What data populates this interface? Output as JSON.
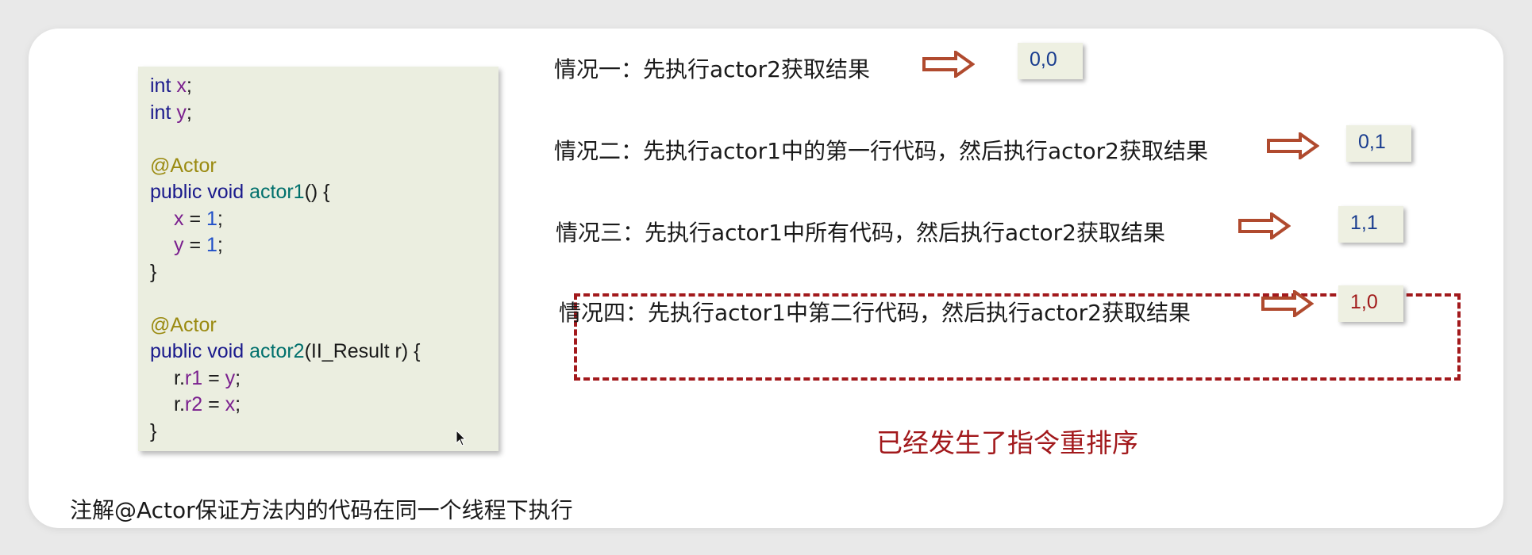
{
  "code": {
    "line1": [
      "int",
      "x",
      ";"
    ],
    "line2": [
      "int",
      "y",
      ";"
    ],
    "line3": "@Actor",
    "line4": [
      "public void",
      "actor1",
      "() {"
    ],
    "line5": [
      "x",
      " = ",
      "1",
      ";"
    ],
    "line6": [
      "y",
      " = ",
      "1",
      ";"
    ],
    "line7": "}",
    "line8": "@Actor",
    "line9": [
      "public void",
      "actor2",
      "(II_Result r) {"
    ],
    "line10": [
      "r.",
      "r1",
      " = ",
      "y",
      ";"
    ],
    "line11": [
      "r.",
      "r2",
      " = ",
      "x",
      ";"
    ],
    "line12": "}"
  },
  "cases": [
    {
      "label": "情况一：先执行actor2获取结果",
      "result": "0,0"
    },
    {
      "label": "情况二：先执行actor1中的第一行代码，然后执行actor2获取结果",
      "result": "0,1"
    },
    {
      "label": "情况三：先执行actor1中所有代码，然后执行actor2获取结果",
      "result": "1,1"
    },
    {
      "label": "情况四：先执行actor1中第二行代码，然后执行actor2获取结果",
      "result": "1,0"
    }
  ],
  "reorder_note": "已经发生了指令重排序",
  "footnote": "注解@Actor保证方法内的代码在同一个线程下执行",
  "colors": {
    "accent_red": "#a2191c",
    "arrow": "#b04a2e",
    "result_blue": "#1a3d8f",
    "code_bg": "#ebeee0"
  },
  "icons": [
    "arrow-right-icon",
    "mouse-cursor-icon"
  ]
}
